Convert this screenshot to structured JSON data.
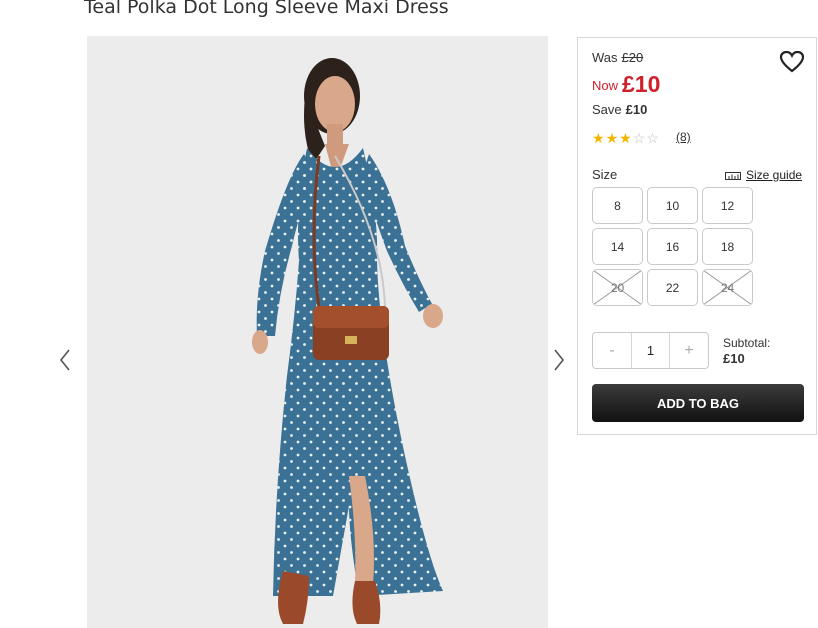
{
  "product": {
    "title": "Teal Polka Dot Long Sleeve Maxi Dress"
  },
  "pricing": {
    "was_label": "Was",
    "was_price": "£20",
    "now_label": "Now",
    "now_price": "£10",
    "save_label": "Save",
    "save_amount": "£10",
    "accent_color": "#d0202a"
  },
  "rating": {
    "stars": 3,
    "max_stars": 5,
    "count": "(8)"
  },
  "size": {
    "label": "Size",
    "guide_label": "Size guide",
    "options": [
      {
        "value": "8",
        "available": true
      },
      {
        "value": "10",
        "available": true
      },
      {
        "value": "12",
        "available": true
      },
      {
        "value": "14",
        "available": true
      },
      {
        "value": "16",
        "available": true
      },
      {
        "value": "18",
        "available": true
      },
      {
        "value": "20",
        "available": false
      },
      {
        "value": "22",
        "available": true
      },
      {
        "value": "24",
        "available": false
      }
    ]
  },
  "quantity": {
    "minus": "-",
    "value": "1",
    "plus": "+"
  },
  "subtotal": {
    "label": "Subtotal:",
    "amount": "£10"
  },
  "cart": {
    "add_label": "ADD TO BAG",
    "button_color": "#1f1f1f"
  },
  "icons": {
    "wishlist": "heart-icon",
    "prev": "chevron-left-icon",
    "next": "chevron-right-icon",
    "guide": "ruler-icon"
  },
  "image": {
    "alt": "Teal Polka Dot Long Sleeve Maxi Dress"
  }
}
